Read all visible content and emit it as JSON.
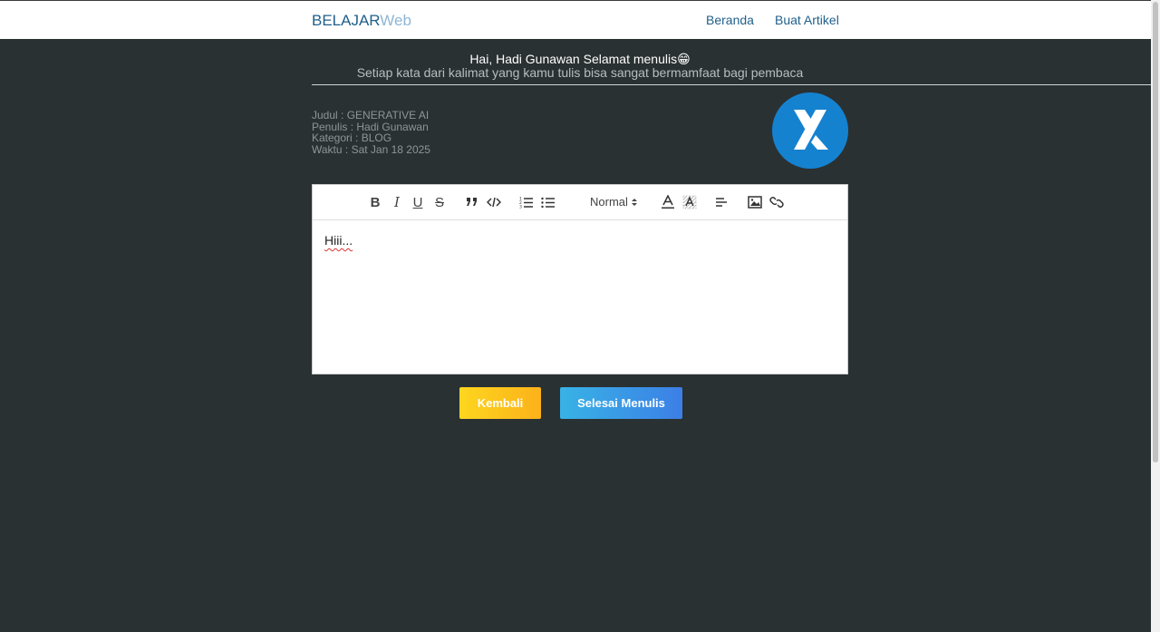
{
  "navbar": {
    "brand_primary": "BELAJAR",
    "brand_secondary": "Web",
    "links": [
      {
        "label": "Beranda"
      },
      {
        "label": "Buat Artikel"
      }
    ]
  },
  "greeting": {
    "title": "Hai, Hadi Gunawan Selamat menulis😁",
    "subtitle": "Setiap kata dari kalimat yang kamu tulis bisa sangat bermamfaat bagi pembaca"
  },
  "meta": {
    "judul": "Judul : GENERATIVE AI",
    "penulis": "Penulis : Hadi Gunawan",
    "kategori": "Kategori : BLOG",
    "waktu": "Waktu : Sat Jan 18 2025"
  },
  "editor": {
    "toolbar": {
      "bold": "B",
      "italic": "I",
      "underline": "U",
      "strike": "S",
      "heading_select": "Normal"
    },
    "content": "Hiii..."
  },
  "actions": {
    "back_label": "Kembali",
    "finish_label": "Selesai Menulis"
  },
  "colors": {
    "background": "#2a3133",
    "brand": "#1f5f8b",
    "logo": "#1582d0",
    "back_button": "#fcc21c",
    "finish_button": "#3a9ae6"
  }
}
